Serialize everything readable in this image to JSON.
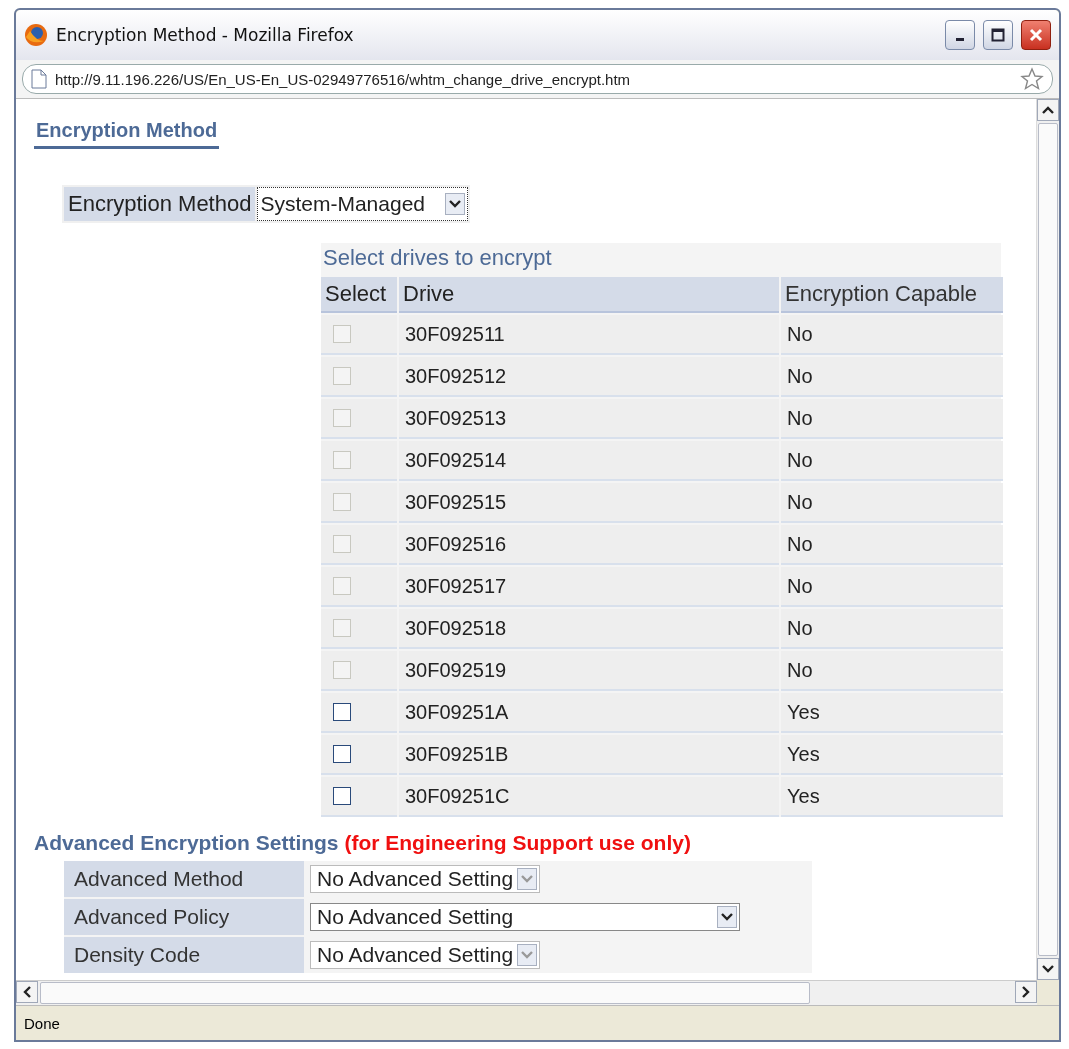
{
  "window": {
    "title": "Encryption Method - Mozilla Firefox"
  },
  "address_bar": {
    "url": "http://9.11.196.226/US/En_US-En_US-02949776516/whtm_change_drive_encrypt.htm"
  },
  "page": {
    "heading": "Encryption Method",
    "method": {
      "label": "Encryption Method",
      "value": "System-Managed"
    },
    "drives_table": {
      "caption": "Select drives to encrypt",
      "columns": [
        "Select",
        "Drive",
        "Encryption Capable"
      ],
      "rows": [
        {
          "checked": false,
          "disabled": true,
          "drive": "30F092511",
          "capable": "No"
        },
        {
          "checked": false,
          "disabled": true,
          "drive": "30F092512",
          "capable": "No"
        },
        {
          "checked": false,
          "disabled": true,
          "drive": "30F092513",
          "capable": "No"
        },
        {
          "checked": false,
          "disabled": true,
          "drive": "30F092514",
          "capable": "No"
        },
        {
          "checked": false,
          "disabled": true,
          "drive": "30F092515",
          "capable": "No"
        },
        {
          "checked": false,
          "disabled": true,
          "drive": "30F092516",
          "capable": "No"
        },
        {
          "checked": false,
          "disabled": true,
          "drive": "30F092517",
          "capable": "No"
        },
        {
          "checked": false,
          "disabled": true,
          "drive": "30F092518",
          "capable": "No"
        },
        {
          "checked": false,
          "disabled": true,
          "drive": "30F092519",
          "capable": "No"
        },
        {
          "checked": false,
          "disabled": false,
          "drive": "30F09251A",
          "capable": "Yes"
        },
        {
          "checked": false,
          "disabled": false,
          "drive": "30F09251B",
          "capable": "Yes"
        },
        {
          "checked": false,
          "disabled": false,
          "drive": "30F09251C",
          "capable": "Yes"
        }
      ]
    },
    "advanced": {
      "title": "Advanced Encryption Settings",
      "note": "(for Engineering Support use only)",
      "settings": [
        {
          "label": "Advanced Method",
          "value": "No Advanced Setting",
          "disabled": true,
          "wide": false
        },
        {
          "label": "Advanced Policy",
          "value": "No Advanced Setting",
          "disabled": false,
          "wide": true
        },
        {
          "label": "Density Code",
          "value": "No Advanced Setting",
          "disabled": true,
          "wide": false
        }
      ]
    }
  },
  "status_bar": {
    "text": "Done"
  }
}
